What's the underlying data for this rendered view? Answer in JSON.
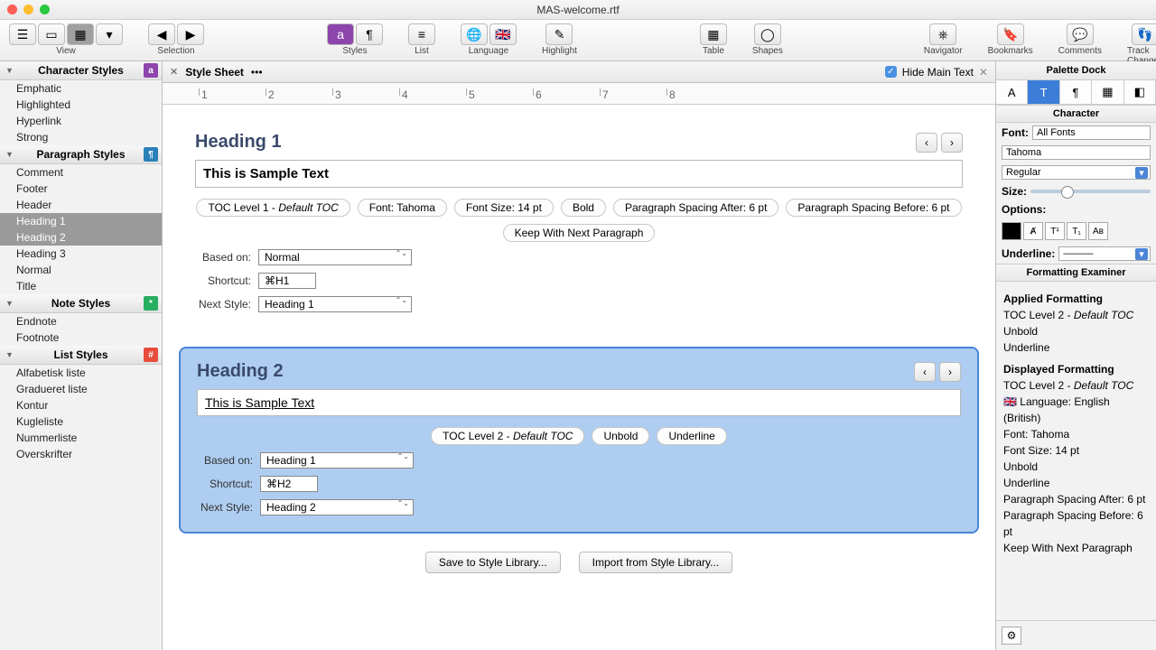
{
  "window": {
    "title": "MAS-welcome.rtf"
  },
  "toolbar": {
    "groups": [
      {
        "label": "View"
      },
      {
        "label": "Selection"
      },
      {
        "label": "Styles"
      },
      {
        "label": "List"
      },
      {
        "label": "Language"
      },
      {
        "label": "Highlight"
      },
      {
        "label": "Table"
      },
      {
        "label": "Shapes"
      },
      {
        "label": "Navigator"
      },
      {
        "label": "Bookmarks"
      },
      {
        "label": "Comments"
      },
      {
        "label": "Track Changes"
      }
    ]
  },
  "left": {
    "char_header": "Character Styles",
    "char_items": [
      "Emphatic",
      "Highlighted",
      "Hyperlink",
      "Strong"
    ],
    "para_header": "Paragraph Styles",
    "para_items": [
      "Comment",
      "Footer",
      "Header",
      "Heading 1",
      "Heading 2",
      "Heading 3",
      "Normal",
      "Title"
    ],
    "para_selected": [
      3,
      4
    ],
    "note_header": "Note Styles",
    "note_items": [
      "Endnote",
      "Footnote"
    ],
    "list_header": "List Styles",
    "list_items": [
      "Alfabetisk liste",
      "Gradueret liste",
      "Kontur",
      "Kugleliste",
      "Nummerliste",
      "Overskrifter"
    ]
  },
  "tab": {
    "label": "Style Sheet",
    "dots": "•••",
    "hide_main": "Hide Main Text"
  },
  "ruler_marks": [
    "1",
    "2",
    "3",
    "4",
    "5",
    "6",
    "7",
    "8"
  ],
  "h1": {
    "name": "Heading 1",
    "sample": "This is Sample Text",
    "pills": [
      "TOC Level 1 - <em>Default TOC</em>",
      "Font: Tahoma",
      "Font Size: 14 pt",
      "Bold",
      "Paragraph Spacing After: 6 pt",
      "Paragraph Spacing Before: 6 pt",
      "Keep With Next Paragraph"
    ],
    "based_on_label": "Based on:",
    "based_on": "Normal",
    "shortcut_label": "Shortcut:",
    "shortcut": "⌘H1",
    "next_label": "Next Style:",
    "next": "Heading 1"
  },
  "h2": {
    "name": "Heading 2",
    "sample": "This is Sample Text",
    "pills": [
      "TOC Level 2 - <em>Default TOC</em>",
      "Unbold",
      "Underline"
    ],
    "based_on_label": "Based on:",
    "based_on": "Heading 1",
    "shortcut_label": "Shortcut:",
    "shortcut": "⌘H2",
    "next_label": "Next Style:",
    "next": "Heading 2"
  },
  "actions": {
    "save": "Save to Style Library...",
    "import": "Import from Style Library..."
  },
  "right": {
    "dock": "Palette Dock",
    "character": "Character",
    "font_label": "Font:",
    "font_filter": "All Fonts",
    "font_name": "Tahoma",
    "font_style": "Regular",
    "size_label": "Size:",
    "options_label": "Options:",
    "underline_label": "Underline:",
    "examiner": "Formatting Examiner",
    "applied_hdr": "Applied Formatting",
    "applied": [
      "TOC Level 2 - Default TOC",
      "Unbold",
      "Underline"
    ],
    "displayed_hdr": "Displayed Formatting",
    "displayed": [
      "TOC Level 2 - Default TOC",
      "🇬🇧 Language: English (British)",
      "Font: Tahoma",
      "Font Size: 14 pt",
      "Unbold",
      "Underline",
      "Paragraph Spacing After: 6 pt",
      "Paragraph Spacing Before: 6 pt",
      "Keep With Next Paragraph"
    ]
  }
}
